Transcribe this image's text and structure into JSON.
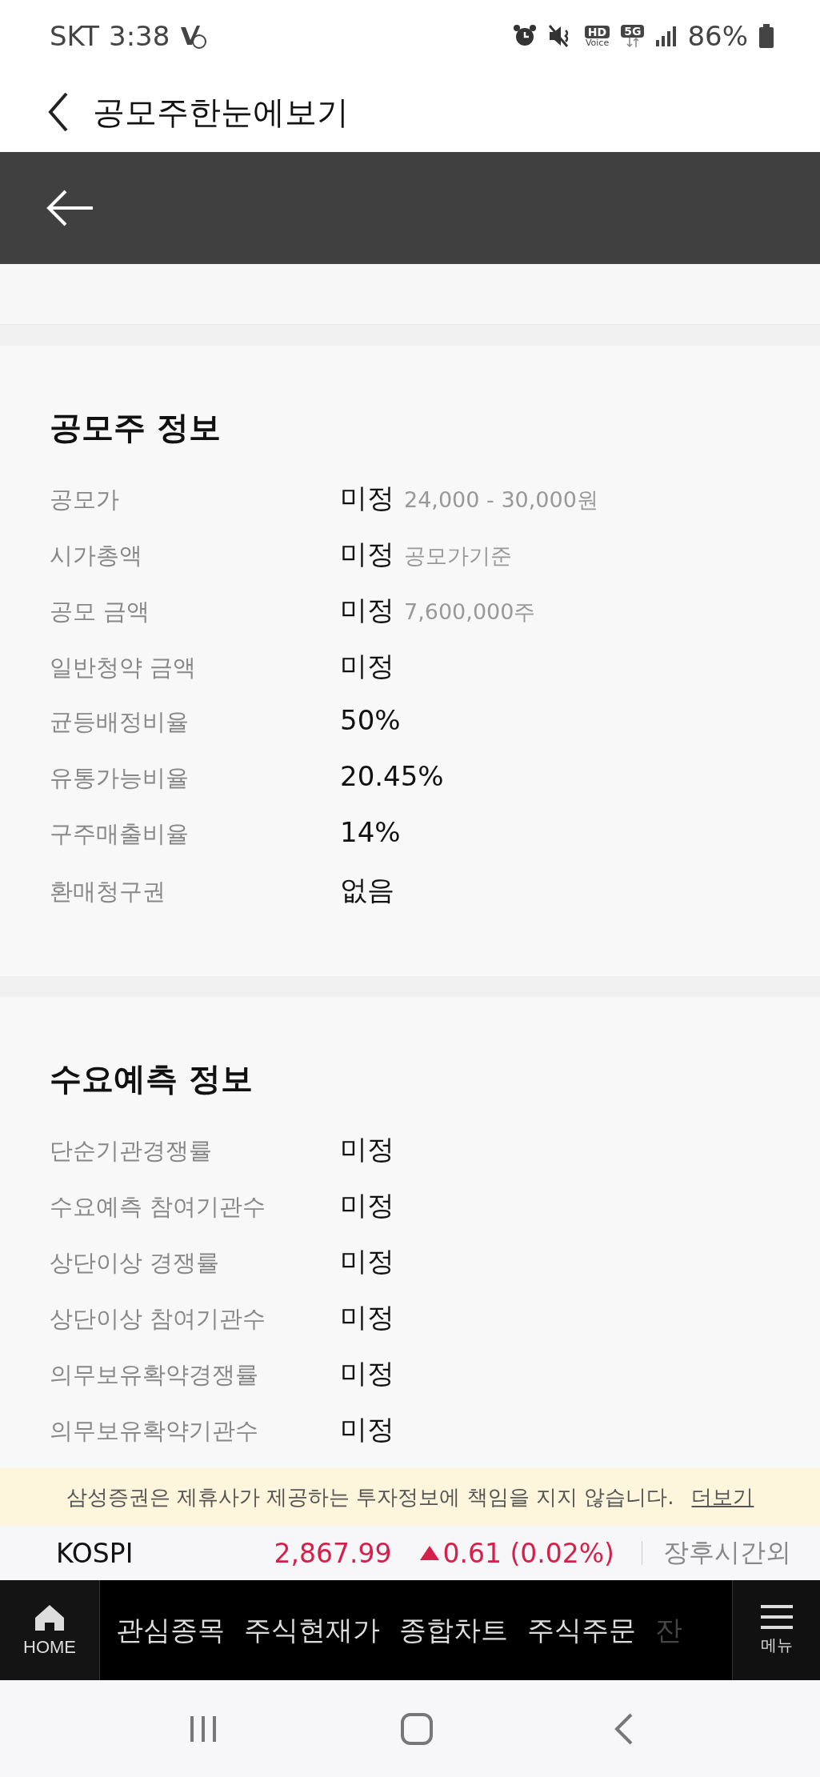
{
  "status_bar": {
    "carrier": "SKT",
    "time": "3:38",
    "hd": "HD",
    "hd_sub": "Voice",
    "network": "5G",
    "battery": "86%"
  },
  "app_bar": {
    "title": "공모주한눈에보기"
  },
  "sections": [
    {
      "title": "공모주 정보",
      "rows": [
        {
          "label": "공모가",
          "value": "미정",
          "note": "24,000 - 30,000원"
        },
        {
          "label": "시가총액",
          "value": "미정",
          "note": "공모가기준"
        },
        {
          "label": "공모 금액",
          "value": "미정",
          "note": "7,600,000주"
        },
        {
          "label": "일반청약 금액",
          "value": "미정"
        },
        {
          "label": "균등배정비율",
          "value": "50%"
        },
        {
          "label": "유통가능비율",
          "value": "20.45%"
        },
        {
          "label": "구주매출비율",
          "value": "14%"
        },
        {
          "label": "환매청구권",
          "value": "없음"
        }
      ]
    },
    {
      "title": "수요예측 정보",
      "rows": [
        {
          "label": "단순기관경쟁률",
          "value": "미정"
        },
        {
          "label": "수요예측 참여기관수",
          "value": "미정"
        },
        {
          "label": "상단이상 경쟁률",
          "value": "미정"
        },
        {
          "label": "상단이상 참여기관수",
          "value": "미정"
        },
        {
          "label": "의무보유확약경쟁률",
          "value": "미정"
        },
        {
          "label": "의무보유확약기관수",
          "value": "미정"
        }
      ]
    }
  ],
  "notice": {
    "text": "삼성증권은 제휴사가 제공하는 투자정보에 책임을 지지 않습니다.",
    "link": "더보기"
  },
  "ticker": {
    "index": "KOSPI",
    "value": "2,867.99",
    "change": "0.61 (0.02%)",
    "session": "장후시간외"
  },
  "bottom_nav": {
    "home": "HOME",
    "items": [
      "관심종목",
      "주식현재가",
      "종합차트",
      "주식주문",
      "잔"
    ],
    "menu": "메뉴"
  }
}
